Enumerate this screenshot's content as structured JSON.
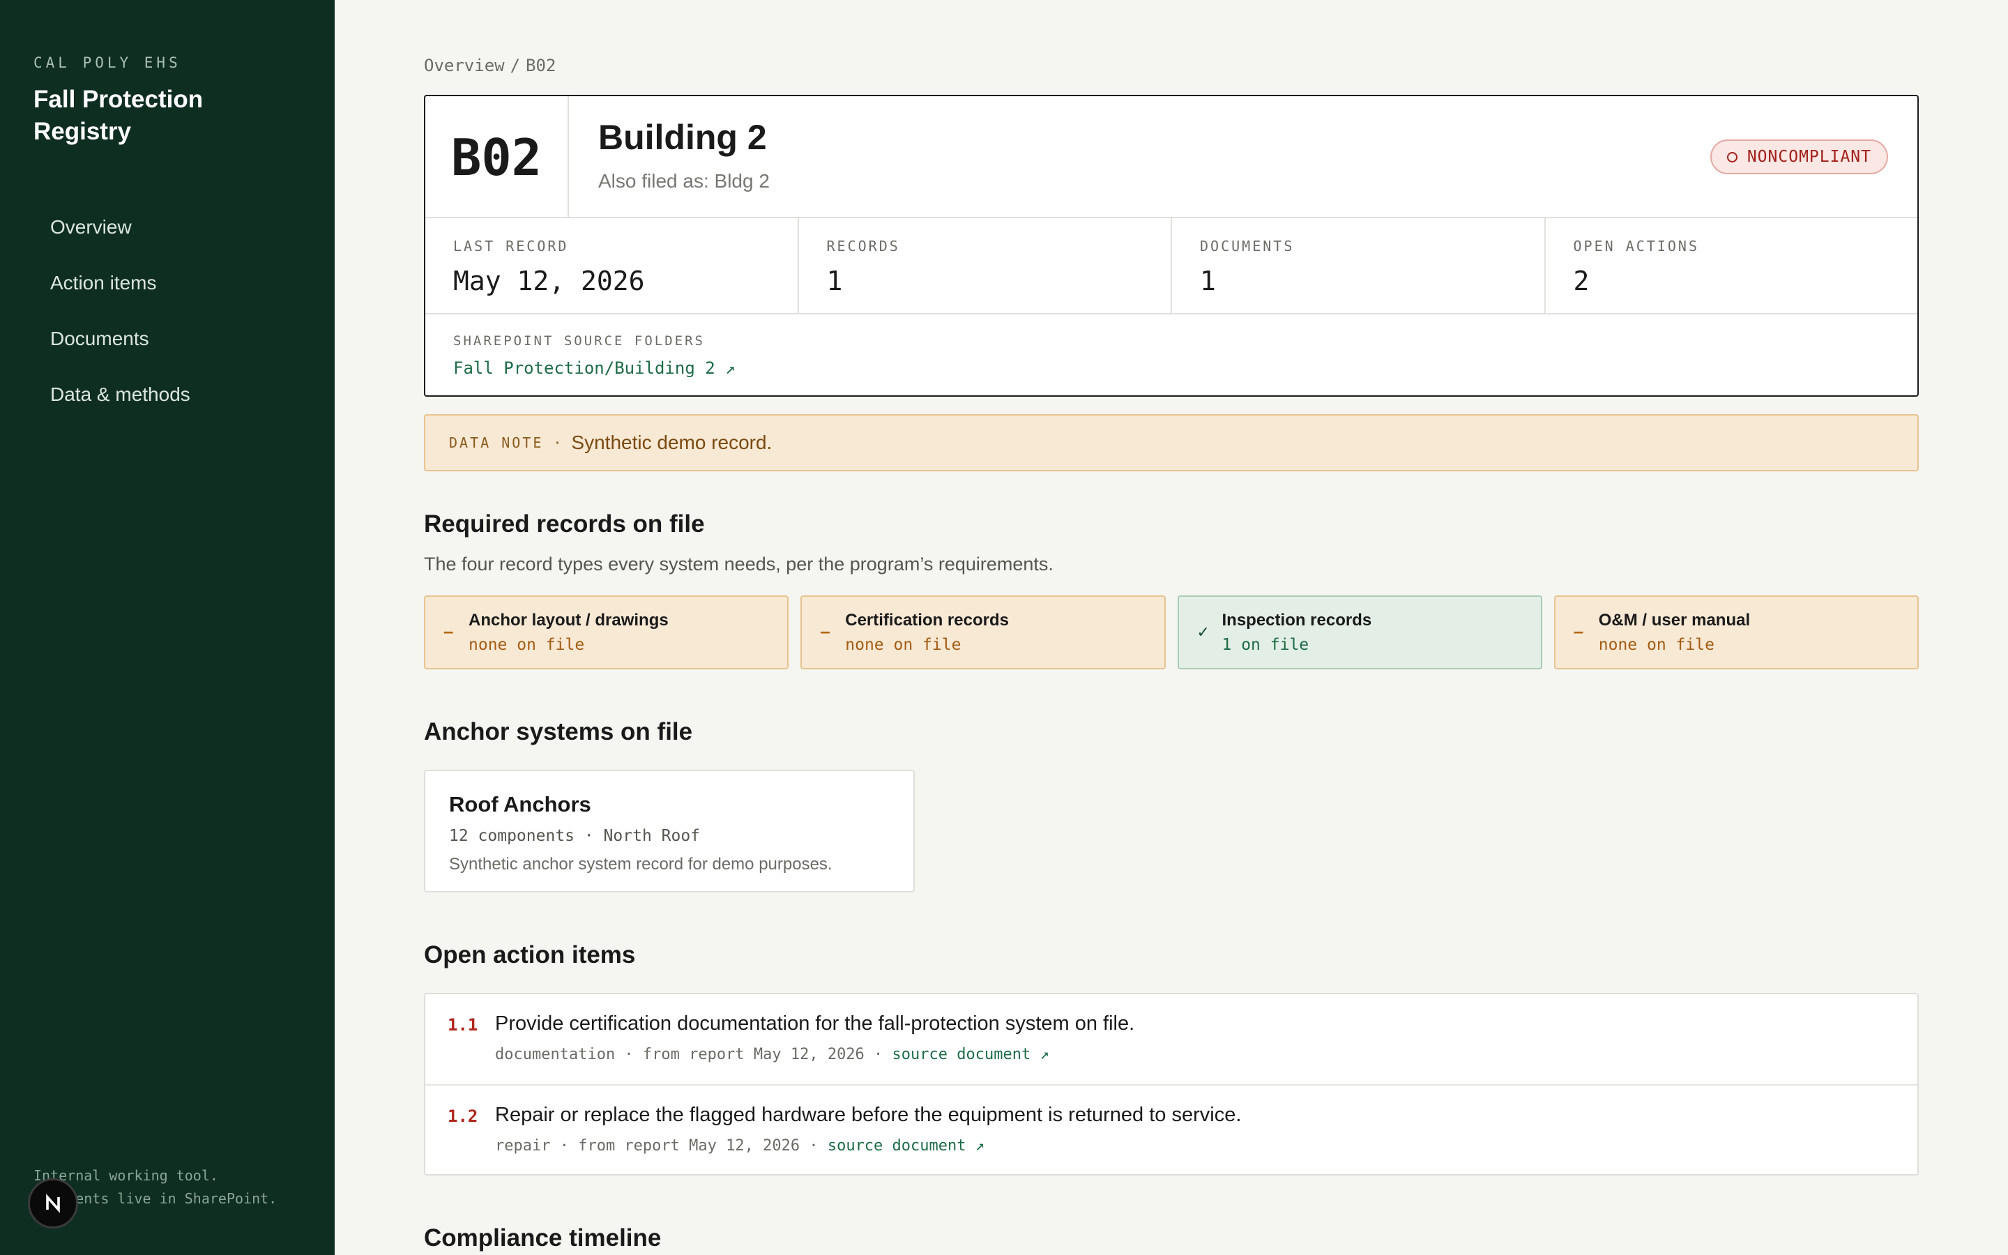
{
  "sidebar": {
    "org": "CAL POLY EHS",
    "title": "Fall Protection Registry",
    "nav": [
      {
        "label": "Overview"
      },
      {
        "label": "Action items"
      },
      {
        "label": "Documents"
      },
      {
        "label": "Data & methods"
      }
    ],
    "footer_line1": "Internal working tool.",
    "footer_line2": "Documents live in SharePoint.",
    "badge_letter": "N"
  },
  "breadcrumb": {
    "root": "Overview",
    "sep": "/",
    "current": "B02"
  },
  "building": {
    "code": "B02",
    "name": "Building 2",
    "alias": "Also filed as: Bldg 2",
    "status": "NONCOMPLIANT"
  },
  "stats": [
    {
      "label": "LAST RECORD",
      "value": "May 12, 2026"
    },
    {
      "label": "RECORDS",
      "value": "1"
    },
    {
      "label": "DOCUMENTS",
      "value": "1"
    },
    {
      "label": "OPEN ACTIONS",
      "value": "2"
    }
  ],
  "sources": {
    "label": "SHAREPOINT SOURCE FOLDERS",
    "link": "Fall Protection/Building 2 ↗"
  },
  "note": {
    "label": "DATA NOTE",
    "sep": "·",
    "text": "Synthetic demo record."
  },
  "required": {
    "title": "Required records on file",
    "subtitle": "The four record types every system needs, per the program’s requirements.",
    "items": [
      {
        "mark": "–",
        "title": "Anchor layout / drawings",
        "count": "none on file",
        "ok": false
      },
      {
        "mark": "–",
        "title": "Certification records",
        "count": "none on file",
        "ok": false
      },
      {
        "mark": "✓",
        "title": "Inspection records",
        "count": "1 on file",
        "ok": true
      },
      {
        "mark": "–",
        "title": "O&M / user manual",
        "count": "none on file",
        "ok": false
      }
    ]
  },
  "anchors": {
    "title": "Anchor systems on file",
    "items": [
      {
        "name": "Roof Anchors",
        "meta": "12 components · North Roof",
        "desc": "Synthetic anchor system record for demo purposes."
      }
    ]
  },
  "actions": {
    "title": "Open action items",
    "items": [
      {
        "num": "1.1",
        "text": "Provide certification documentation for the fall-protection system on file.",
        "meta": "documentation · from report May 12, 2026 · ",
        "link": "source document ↗"
      },
      {
        "num": "1.2",
        "text": "Repair or replace the flagged hardware before the equipment is returned to service.",
        "meta": "repair · from report May 12, 2026 · ",
        "link": "source document ↗"
      }
    ]
  },
  "timeline": {
    "title": "Compliance timeline"
  },
  "colors": {
    "sidebar_bg": "#0f2e22",
    "accent_link": "#1d6b48",
    "danger": "#a3211a",
    "warn_bg": "#f8e9d5",
    "ok_bg": "#e3efe6"
  }
}
